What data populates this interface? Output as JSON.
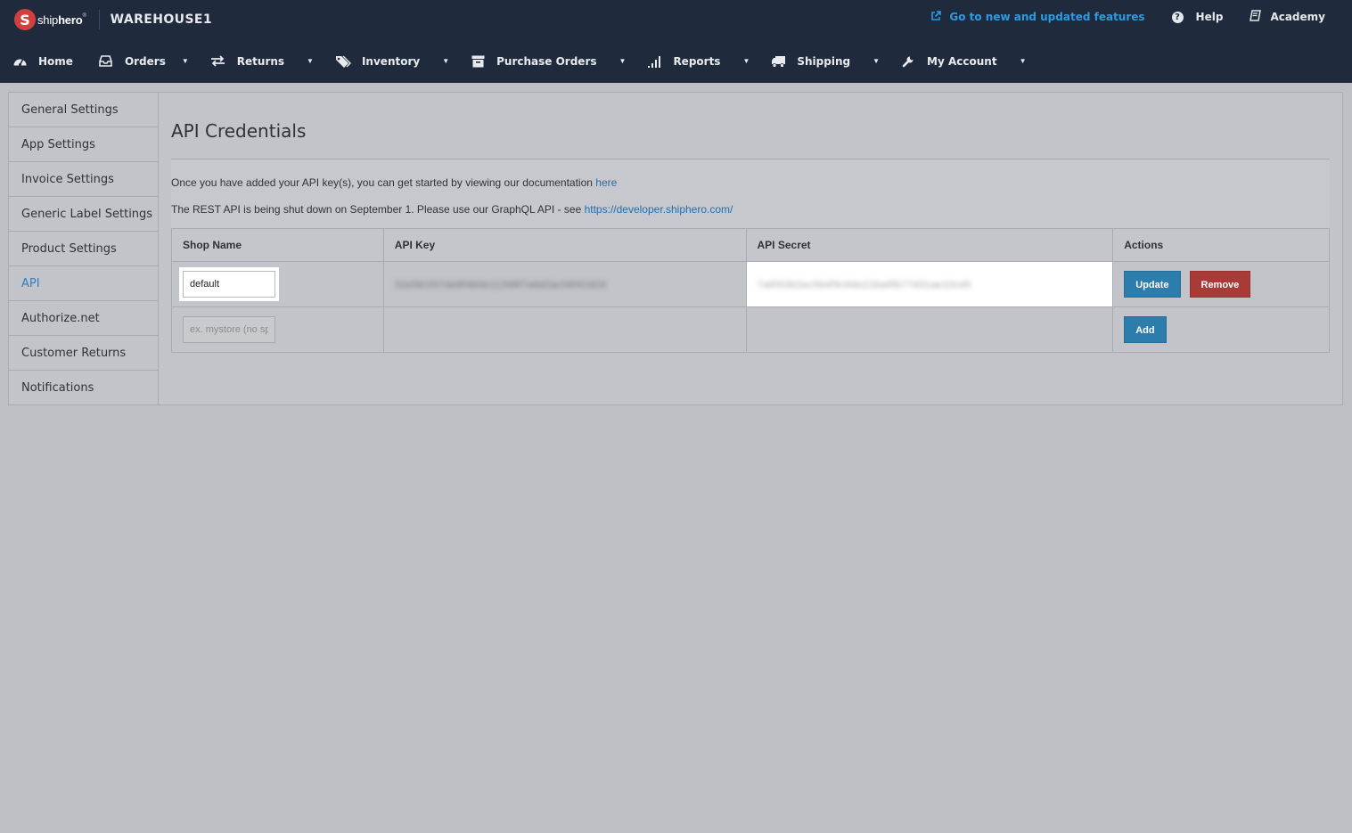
{
  "header": {
    "logo_text_light": "ship",
    "logo_text_bold": "hero",
    "logo_tm": "®",
    "warehouse": "WAREHOUSE1",
    "new_features_link": "Go to new and updated features",
    "help_label": "Help",
    "help_icon": "?",
    "academy_label": "Academy"
  },
  "nav": {
    "home": "Home",
    "orders": "Orders",
    "returns": "Returns",
    "inventory": "Inventory",
    "purchase_orders": "Purchase Orders",
    "reports": "Reports",
    "shipping": "Shipping",
    "my_account": "My Account"
  },
  "sidebar": {
    "items": [
      {
        "label": "General Settings"
      },
      {
        "label": "App Settings"
      },
      {
        "label": "Invoice Settings"
      },
      {
        "label": "Generic Label Settings"
      },
      {
        "label": "Product Settings"
      },
      {
        "label": "API"
      },
      {
        "label": "Authorize.net"
      },
      {
        "label": "Customer Returns"
      },
      {
        "label": "Notifications"
      }
    ],
    "active": "API"
  },
  "main": {
    "title": "API Credentials",
    "info1_text": "Once you have added your API key(s), you can get started by viewing our documentation ",
    "info1_link": "here",
    "info2_text": "The REST API is being shut down on September 1. Please use our GraphQL API - see ",
    "info2_link": "https://developer.shiphero.com/",
    "table": {
      "headers": [
        "Shop Name",
        "API Key",
        "API Secret",
        "Actions"
      ],
      "row1": {
        "shop_name": "default",
        "api_key": "32e5b1f07de8f4b0e11268f7a9d2ac06f4182d",
        "api_secret": "7a6f43b2ec5b4f9c8de21ba6fb77d31ae10cd5",
        "update_label": "Update",
        "remove_label": "Remove"
      },
      "row2": {
        "shop_placeholder": "ex. mystore (no spaces)",
        "add_label": "Add"
      }
    }
  },
  "colors": {
    "nav_bg": "#1f2b3d",
    "accent_link": "#2d9be0",
    "button_blue": "#2c7cac",
    "button_red": "#a83a38",
    "page_bg": "#bec0c5"
  },
  "icons": {
    "new_features": "external-link-icon",
    "help": "question-circle-icon",
    "academy": "book-icon",
    "home": "dashboard-icon",
    "orders": "inbox-icon",
    "returns": "exchange-icon",
    "inventory": "tags-icon",
    "purchase_orders": "archive-icon",
    "reports": "signal-bars-icon",
    "shipping": "truck-icon",
    "my_account": "wrench-icon"
  }
}
